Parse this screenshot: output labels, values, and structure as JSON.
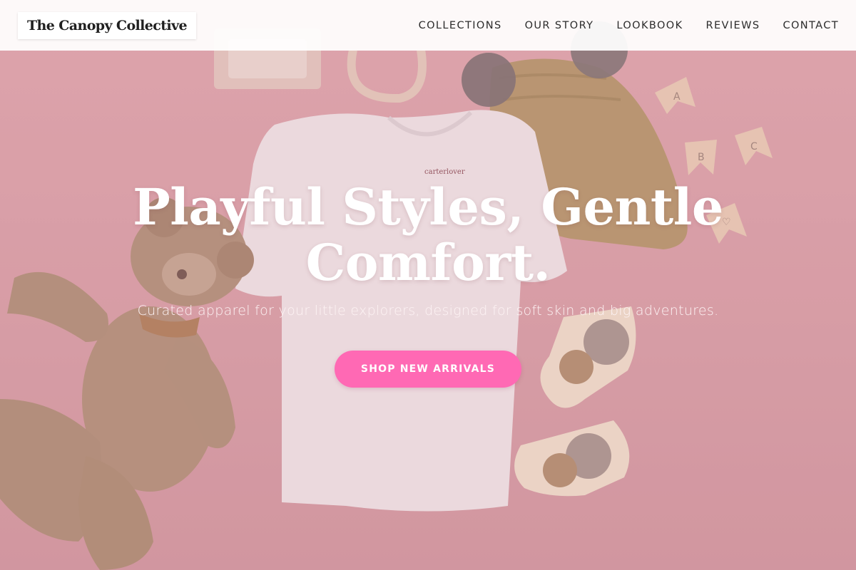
{
  "brand": {
    "name": "The Canopy Collective"
  },
  "nav": {
    "items": [
      {
        "label": "COLLECTIONS"
      },
      {
        "label": "OUR STORY"
      },
      {
        "label": "LOOKBOOK"
      },
      {
        "label": "REVIEWS"
      },
      {
        "label": "CONTACT"
      }
    ]
  },
  "hero": {
    "headline_line1": "Playful Styles, Gentle",
    "headline_line2": "Comfort.",
    "subtitle": "Curated apparel for your little explorers, designed for soft skin and big adventures.",
    "cta_label": "SHOP NEW ARRIVALS",
    "background_description_icons": [
      "teddy-bear",
      "tshirt",
      "knit-hat",
      "bear-socks",
      "letter-flags"
    ],
    "tag_text": "carterlover",
    "flag_letters": [
      "A",
      "B",
      "C",
      "♡"
    ]
  },
  "colors": {
    "accent": "#ff69b4",
    "background_pink": "#d79ea6",
    "header_bg": "#ffffff"
  }
}
